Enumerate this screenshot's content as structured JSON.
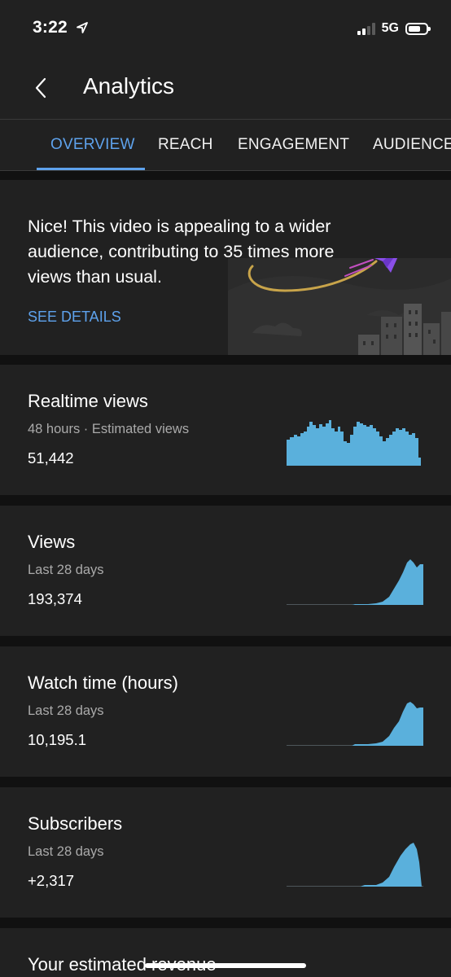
{
  "status_bar": {
    "time": "3:22",
    "network": "5G"
  },
  "header": {
    "title": "Analytics"
  },
  "tabs": [
    {
      "label": "OVERVIEW",
      "active": true
    },
    {
      "label": "REACH"
    },
    {
      "label": "ENGAGEMENT"
    },
    {
      "label": "AUDIENCE"
    }
  ],
  "insight": {
    "text": "Nice! This video is appealing to a wider audience, contributing to 35 times more views than usual.",
    "action": "SEE DETAILS"
  },
  "metrics": [
    {
      "title": "Realtime views",
      "subtitle": "48 hours · Estimated views",
      "value": "51,442"
    },
    {
      "title": "Views",
      "subtitle": "Last 28 days",
      "value": "193,374"
    },
    {
      "title": "Watch time (hours)",
      "subtitle": "Last 28 days",
      "value": "10,195.1"
    },
    {
      "title": "Subscribers",
      "subtitle": "Last 28 days",
      "value": "+2,317"
    }
  ],
  "partial_card": {
    "title": "Your estimated revenue"
  },
  "colors": {
    "accent": "#5ea2ec",
    "chart": "#5ab0dc",
    "card": "#212121",
    "background": "#111111"
  },
  "icons": [
    "location-arrow-icon",
    "signal-icon",
    "battery-icon",
    "back-arrow-icon",
    "paper-plane-icon"
  ]
}
